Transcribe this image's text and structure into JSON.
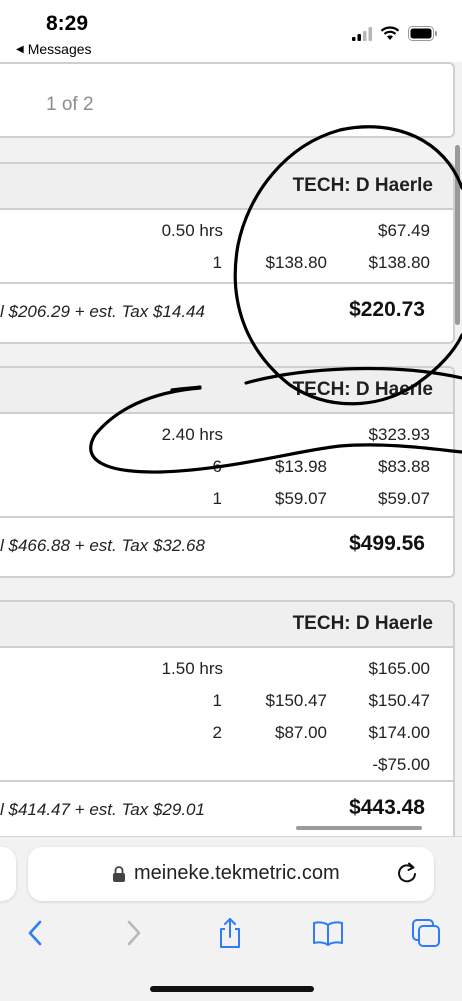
{
  "status_bar": {
    "time": "8:29",
    "back_label": "Messages",
    "icons": [
      "cellular-signal-icon",
      "wifi-icon",
      "battery-icon"
    ]
  },
  "pager": {
    "text": "1 of 2"
  },
  "cards": [
    {
      "tech": "TECH: D Haerle",
      "rows": [
        {
          "hours": "0.50 hrs",
          "total": "$67.49"
        },
        {
          "qty": "1",
          "unit": "$138.80",
          "total": "$138.80"
        }
      ],
      "subtotal": "l $206.29 + est. Tax $14.44",
      "grand_total": "$220.73"
    },
    {
      "tech": "TECH: D Haerle",
      "rows": [
        {
          "hours": "2.40 hrs",
          "total": "$323.93"
        },
        {
          "qty": "6",
          "unit": "$13.98",
          "total": "$83.88"
        },
        {
          "qty": "1",
          "unit": "$59.07",
          "total": "$59.07"
        }
      ],
      "subtotal": "l $466.88 + est. Tax $32.68",
      "grand_total": "$499.56"
    },
    {
      "tech": "TECH: D Haerle",
      "rows": [
        {
          "hours": "1.50 hrs",
          "total": "$165.00"
        },
        {
          "qty": "1",
          "unit": "$150.47",
          "total": "$150.47"
        },
        {
          "qty": "2",
          "unit": "$87.00",
          "total": "$174.00"
        },
        {
          "total": "-$75.00"
        }
      ],
      "subtotal": "l $414.47 + est. Tax $29.01",
      "grand_total": "$443.48"
    }
  ],
  "browser": {
    "url": "meineke.tekmetric.com",
    "toolbar": [
      "back-icon",
      "forward-icon",
      "share-icon",
      "bookmarks-icon",
      "tabs-icon"
    ],
    "accent_color": "#2f7cf6"
  }
}
